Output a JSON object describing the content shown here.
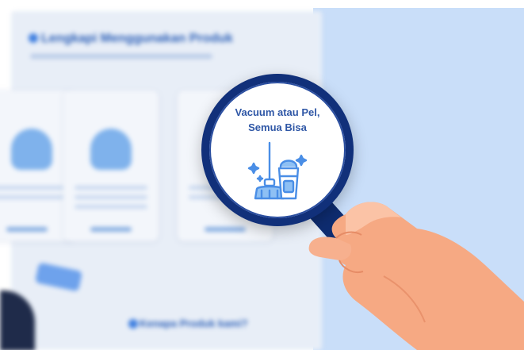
{
  "magnifier": {
    "line1": "Vacuum atau Pel,",
    "line2": "Semua Bisa",
    "icon": "cleaning-broom-bucket-icon"
  },
  "background_page": {
    "title": "Lengkapi Menggunakan Produk",
    "section_title": "Kenapa Produk kami?"
  },
  "colors": {
    "lens_ring": "#11307a",
    "text_blue": "#2f57a6",
    "icon_blue": "#4a8ee6",
    "sky": "#c9def9",
    "skin": "#f6a983"
  }
}
